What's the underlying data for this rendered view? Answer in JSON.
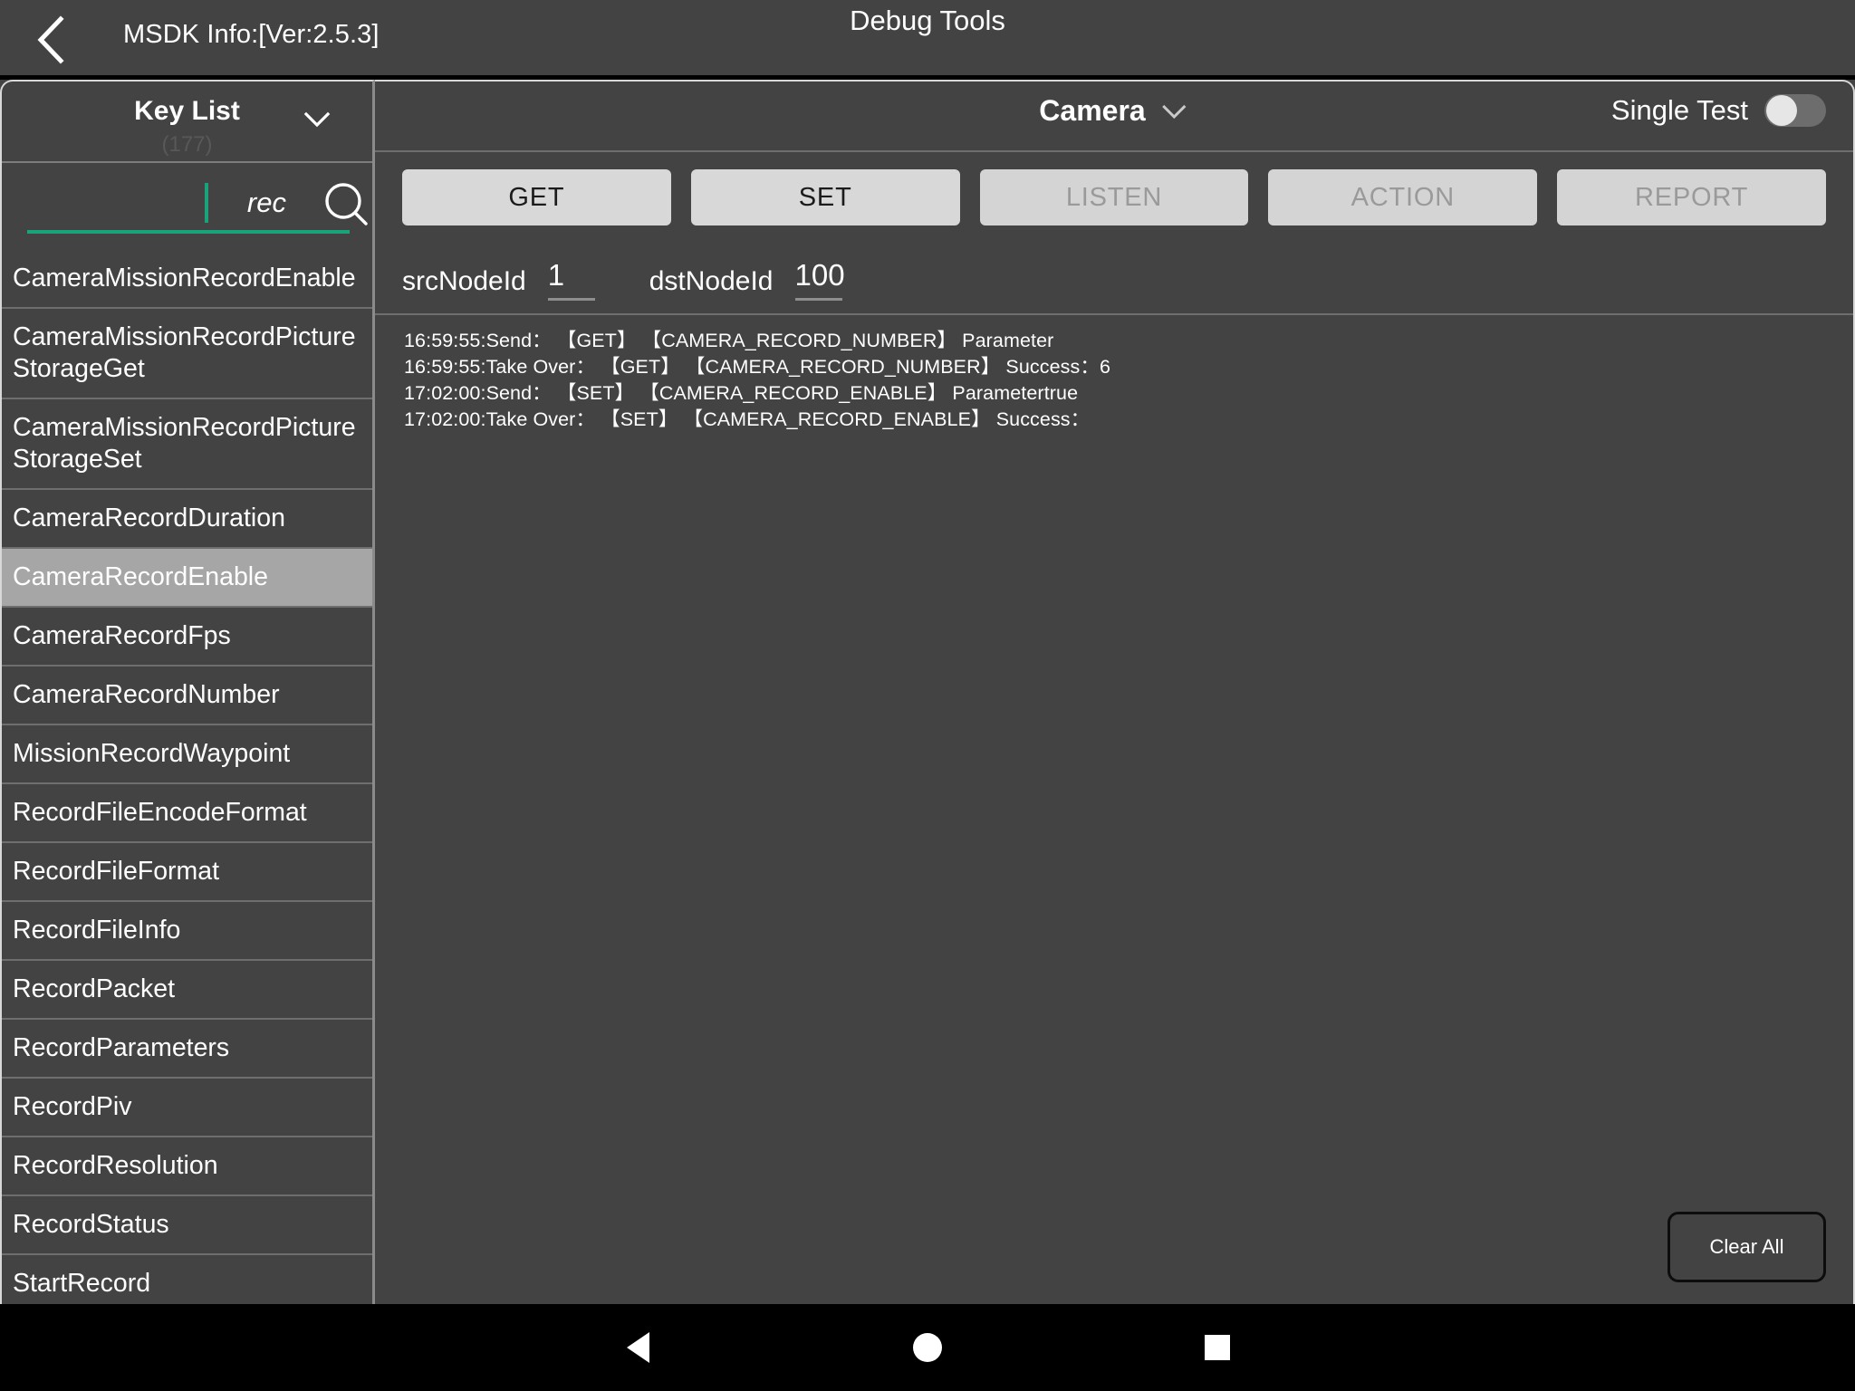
{
  "topbar": {
    "back_icon": "back-chevron-icon",
    "msdk_info": "MSDK Info:[Ver:2.5.3]",
    "title": "Debug Tools"
  },
  "sidebar": {
    "title": "Key List",
    "count": "(177)",
    "collapse_icon": "chevron-down-icon",
    "search": {
      "value": "rec",
      "placeholder": "search",
      "icon": "search-icon",
      "accent_color": "#1aa37a"
    },
    "items": [
      {
        "label": "CameraMissionRecordEnable",
        "selected": false
      },
      {
        "label": "CameraMissionRecordPictureStorageGet",
        "selected": false
      },
      {
        "label": "CameraMissionRecordPictureStorageSet",
        "selected": false
      },
      {
        "label": "CameraRecordDuration",
        "selected": false
      },
      {
        "label": "CameraRecordEnable",
        "selected": true
      },
      {
        "label": "CameraRecordFps",
        "selected": false
      },
      {
        "label": "CameraRecordNumber",
        "selected": false
      },
      {
        "label": "MissionRecordWaypoint",
        "selected": false
      },
      {
        "label": "RecordFileEncodeFormat",
        "selected": false
      },
      {
        "label": "RecordFileFormat",
        "selected": false
      },
      {
        "label": "RecordFileInfo",
        "selected": false
      },
      {
        "label": "RecordPacket",
        "selected": false
      },
      {
        "label": "RecordParameters",
        "selected": false
      },
      {
        "label": "RecordPiv",
        "selected": false
      },
      {
        "label": "RecordResolution",
        "selected": false
      },
      {
        "label": "RecordStatus",
        "selected": false
      },
      {
        "label": "StartRecord",
        "selected": false
      }
    ]
  },
  "main": {
    "module": {
      "label": "Camera",
      "chevron_icon": "chevron-down-icon"
    },
    "single_test": {
      "label": "Single Test",
      "enabled": false
    },
    "actions": [
      {
        "label": "GET",
        "disabled": false
      },
      {
        "label": "SET",
        "disabled": false
      },
      {
        "label": "LISTEN",
        "disabled": true
      },
      {
        "label": "ACTION",
        "disabled": true
      },
      {
        "label": "REPORT",
        "disabled": true
      }
    ],
    "nodes": {
      "src_label": "srcNodeId",
      "src_value": "1",
      "dst_label": "dstNodeId",
      "dst_value": "100"
    },
    "log_lines": [
      "16:59:55:Send：  【GET】  【CAMERA_RECORD_NUMBER】 Parameter",
      "16:59:55:Take Over：  【GET】  【CAMERA_RECORD_NUMBER】 Success：6",
      "17:02:00:Send：  【SET】  【CAMERA_RECORD_ENABLE】 Parametertrue",
      "17:02:00:Take Over：  【SET】  【CAMERA_RECORD_ENABLE】 Success："
    ],
    "clear_all_label": "Clear All"
  },
  "navbar": {
    "back_label": "back-triangle-icon",
    "home_label": "home-circle-icon",
    "recents_label": "recents-square-icon"
  }
}
